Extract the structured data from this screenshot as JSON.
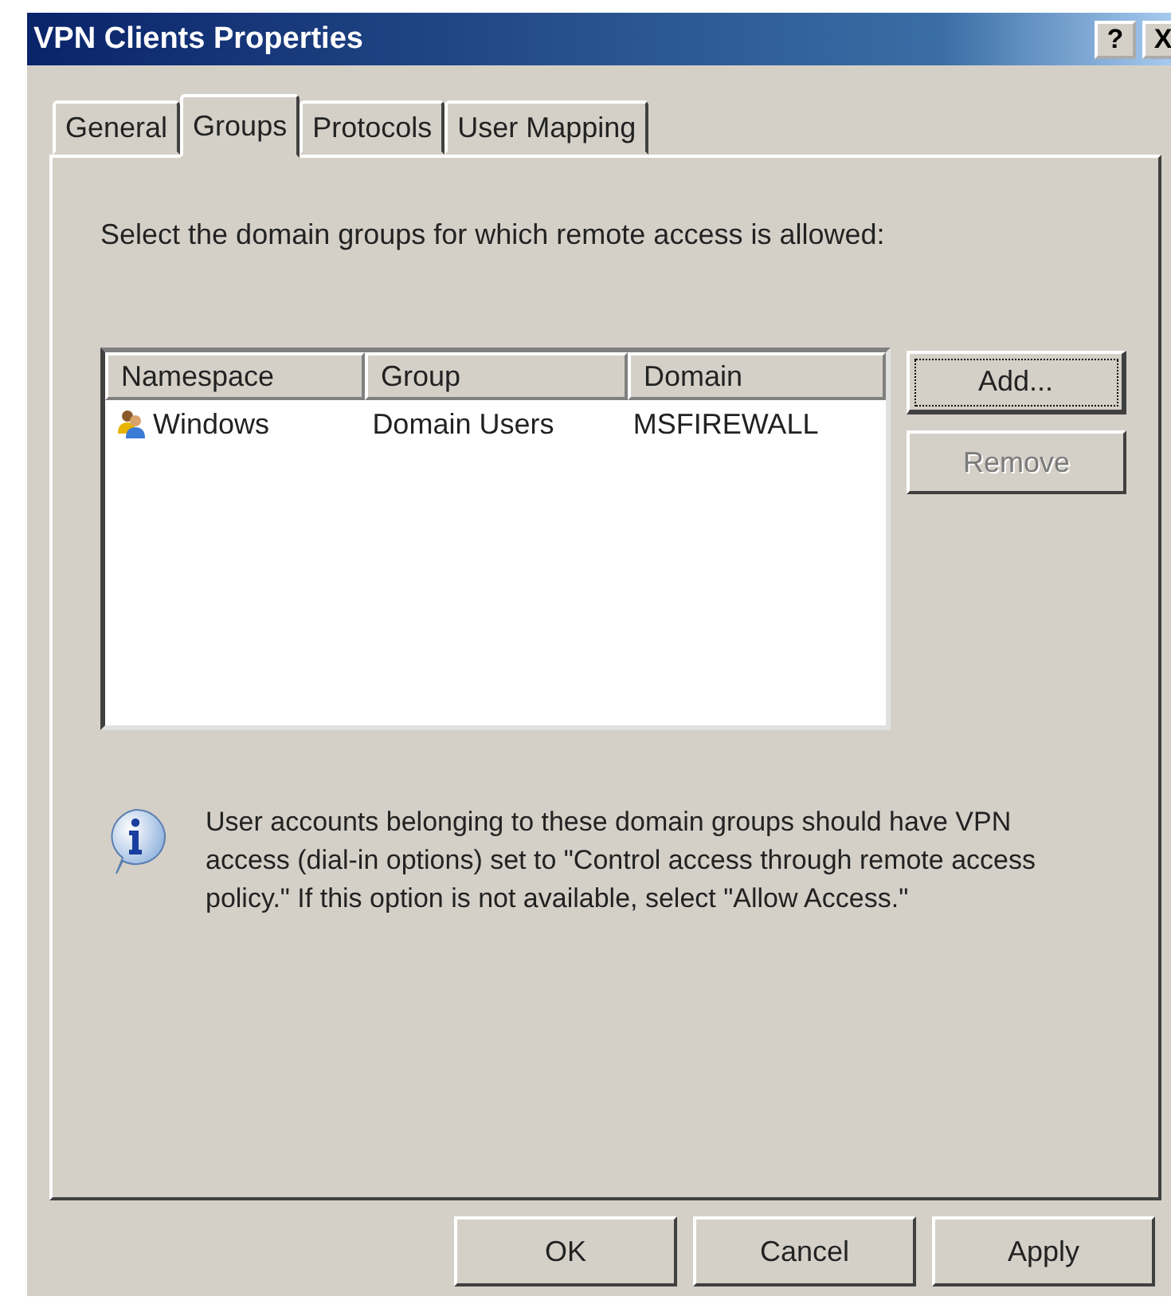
{
  "window": {
    "title": "VPN Clients Properties",
    "title_buttons": [
      "?",
      "X"
    ]
  },
  "tabs": [
    {
      "label": "General",
      "selected": false
    },
    {
      "label": "Groups",
      "selected": true
    },
    {
      "label": "Protocols",
      "selected": false
    },
    {
      "label": "User Mapping",
      "selected": false
    }
  ],
  "instruction": "Select the domain groups for which remote access is allowed:",
  "table": {
    "columns": [
      "Namespace",
      "Group",
      "Domain"
    ],
    "rows": [
      {
        "cells": [
          "Windows",
          "Domain Users",
          "MSFIREWALL"
        ]
      }
    ]
  },
  "side_buttons": [
    {
      "label": "Add...",
      "disabled": false,
      "focused": true
    },
    {
      "label": "Remove",
      "disabled": true,
      "focused": false
    }
  ],
  "info_text": "User accounts belonging to these domain groups should have VPN access (dial-in options) set to \"Control access through remote access policy.\" If this option is not available, select \"Allow Access.\"",
  "buttons": [
    "OK",
    "Cancel",
    "Apply"
  ]
}
